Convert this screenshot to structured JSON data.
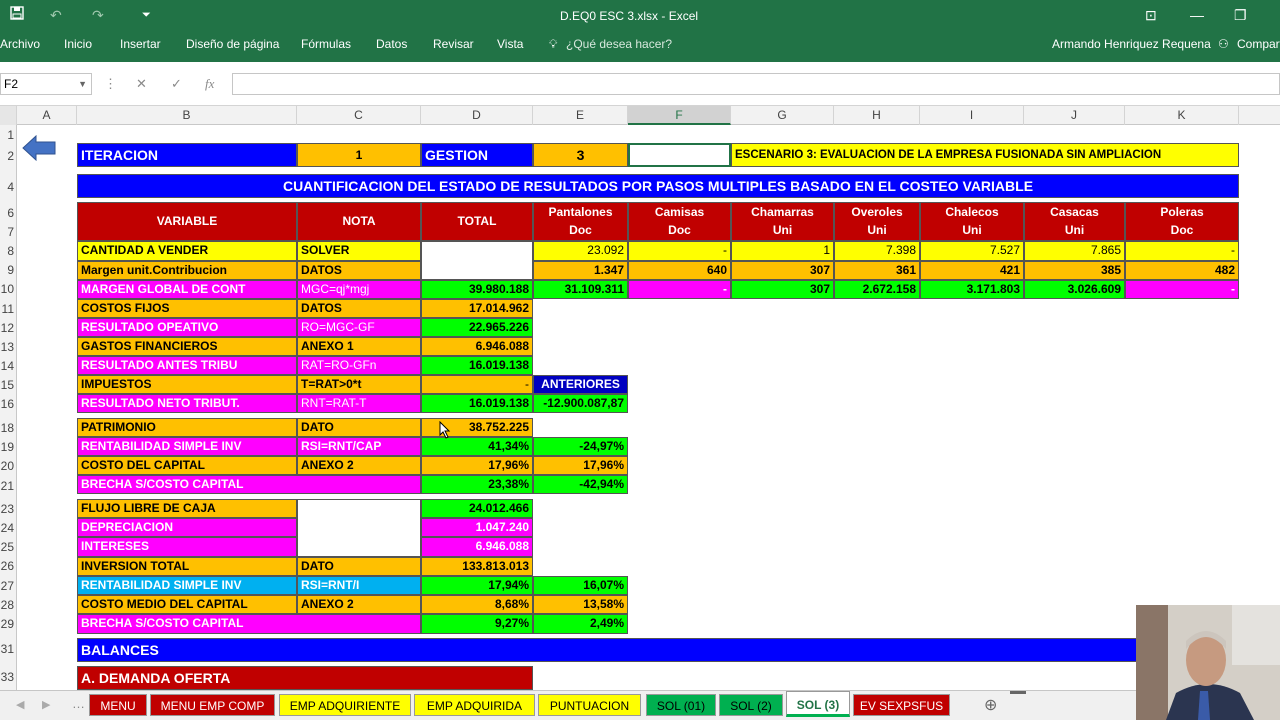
{
  "titlebar": {
    "title": "D.EQ0 ESC 3.xlsx - Excel"
  },
  "ribbon": {
    "menu": [
      "Archivo",
      "Inicio",
      "Insertar",
      "Diseño de página",
      "Fórmulas",
      "Datos",
      "Revisar",
      "Vista"
    ],
    "tell_me": "¿Qué desea hacer?",
    "user": "Armando Henriquez Requena",
    "share": "Compartir"
  },
  "formula_bar": {
    "namebox": "F2",
    "fx": "fx",
    "formula": ""
  },
  "columns": [
    "A",
    "B",
    "C",
    "D",
    "E",
    "F",
    "G",
    "H",
    "I",
    "J",
    "K"
  ],
  "rows": [
    "1",
    "2",
    "4",
    "6",
    "7",
    "8",
    "9",
    "10",
    "11",
    "12",
    "13",
    "14",
    "15",
    "16",
    "18",
    "19",
    "20",
    "21",
    "23",
    "24",
    "25",
    "26",
    "27",
    "28",
    "29",
    "31",
    "33"
  ],
  "header_row": {
    "iteracion": "ITERACION",
    "iter_val": "1",
    "gestion": "GESTION",
    "gest_val": "3",
    "escenario": "ESCENARIO 3: EVALUACION DE LA EMPRESA FUSIONADA SIN AMPLIACION"
  },
  "main_title": "CUANTIFICACION DEL ESTADO DE RESULTADOS POR PASOS MULTIPLES BASADO EN EL COSTEO VARIABLE",
  "table_head": {
    "variable": "VARIABLE",
    "nota": "NOTA",
    "total": "TOTAL",
    "products": [
      {
        "name": "Pantalones",
        "unit": "Doc"
      },
      {
        "name": "Camisas",
        "unit": "Doc"
      },
      {
        "name": "Chamarras",
        "unit": "Uni"
      },
      {
        "name": "Overoles",
        "unit": "Uni"
      },
      {
        "name": "Chalecos",
        "unit": "Uni"
      },
      {
        "name": "Casacas",
        "unit": "Uni"
      },
      {
        "name": "Poleras",
        "unit": "Doc"
      }
    ]
  },
  "rows_data": {
    "cantidad": {
      "label": "CANTIDAD A VENDER",
      "nota": "SOLVER",
      "total": "",
      "vals": [
        "23.092",
        "-",
        "1",
        "7.398",
        "7.527",
        "7.865",
        "-"
      ]
    },
    "margen": {
      "label": "Margen unit.Contribucion",
      "nota": "DATOS",
      "total": "",
      "vals": [
        "1.347",
        "640",
        "307",
        "361",
        "421",
        "385",
        "482"
      ]
    },
    "mgc": {
      "label": "MARGEN GLOBAL DE CONT",
      "nota": "MGC=qj*mgj",
      "total": "39.980.188",
      "vals": [
        "31.109.311",
        "-",
        "307",
        "2.672.158",
        "3.171.803",
        "3.026.609",
        "-"
      ]
    },
    "costos": {
      "label": "COSTOS FIJOS",
      "nota": "DATOS",
      "total": "17.014.962"
    },
    "ro": {
      "label": "RESULTADO OPEATIVO",
      "nota": "RO=MGC-GF",
      "total": "22.965.226"
    },
    "gf": {
      "label": "GASTOS FINANCIEROS",
      "nota": "ANEXO 1",
      "total": "6.946.088"
    },
    "rat": {
      "label": "RESULTADO ANTES TRIBU",
      "nota": "RAT=RO-GFn",
      "total": "16.019.138"
    },
    "imp": {
      "label": "IMPUESTOS",
      "nota": "T=RAT>0*t",
      "total": "-",
      "extra": "ANTERIORES"
    },
    "rnt": {
      "label": "RESULTADO NETO TRIBUT.",
      "nota": "RNT=RAT-T",
      "total": "16.019.138",
      "extra": "-12.900.087,87"
    },
    "patr": {
      "label": "PATRIMONIO",
      "nota": "DATO",
      "total": "38.752.225"
    },
    "rsi": {
      "label": "RENTABILIDAD SIMPLE INV",
      "nota": "RSI=RNT/CAP",
      "total": "41,34%",
      "extra": "-24,97%"
    },
    "cc": {
      "label": "COSTO DEL CAPITAL",
      "nota": "ANEXO 2",
      "total": "17,96%",
      "extra": "17,96%"
    },
    "brecha": {
      "label": "BRECHA S/COSTO CAPITAL",
      "total": "23,38%",
      "extra": "-42,94%"
    },
    "flujo": {
      "label": "FLUJO LIBRE DE CAJA",
      "total": "24.012.466"
    },
    "depr": {
      "label": "DEPRECIACION",
      "total": "1.047.240"
    },
    "inter": {
      "label": "INTERESES",
      "total": "6.946.088"
    },
    "inv": {
      "label": "INVERSION TOTAL",
      "nota": "DATO",
      "total": "133.813.013"
    },
    "rsi2": {
      "label": "RENTABILIDAD SIMPLE INV",
      "nota": "RSI=RNT/I",
      "total": "17,94%",
      "extra": "16,07%"
    },
    "cmc": {
      "label": "COSTO MEDIO DEL CAPITAL",
      "nota": "ANEXO 2",
      "total": "8,68%",
      "extra": "13,58%"
    },
    "brecha2": {
      "label": "BRECHA S/COSTO CAPITAL",
      "total": "9,27%",
      "extra": "2,49%"
    }
  },
  "balances": "BALANCES",
  "demanda": "A. DEMANDA OFERTA",
  "sheet_tabs": [
    "MENU",
    "MENU EMP COMP",
    "EMP ADQUIRIENTE",
    "EMP ADQUIRIDA",
    "PUNTUACION",
    "SOL (01)",
    "SOL (2)",
    "SOL (3)",
    "EV SEXPSFUS"
  ],
  "active_tab": "SOL (3)",
  "colors": {
    "excel_green": "#217346",
    "orange": "#ffc000",
    "yellow": "#ffff00",
    "magenta": "#ff00ff",
    "green": "#00ff00",
    "red": "#c00000",
    "blue": "#0000ff"
  }
}
